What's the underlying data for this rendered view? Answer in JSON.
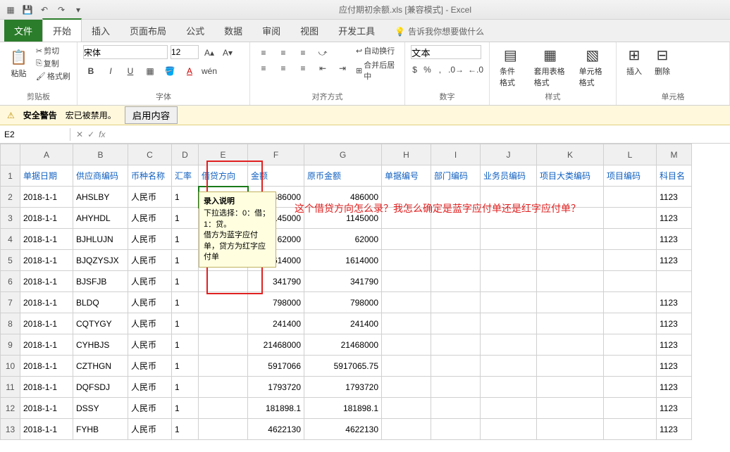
{
  "title": "应付期初余额.xls [兼容模式] - Excel",
  "qat_icons": [
    "excel-icon",
    "save-icon",
    "undo-icon",
    "redo-icon",
    "more-icon"
  ],
  "tabs": {
    "file": "文件",
    "home": "开始",
    "insert": "插入",
    "layout": "页面布局",
    "formulas": "公式",
    "data": "数据",
    "review": "审阅",
    "view": "视图",
    "dev": "开发工具",
    "tellme": "告诉我你想要做什么"
  },
  "ribbon": {
    "clipboard": {
      "paste": "粘贴",
      "cut": "剪切",
      "copy": "复制",
      "painter": "格式刷",
      "label": "剪贴板"
    },
    "font": {
      "name": "宋体",
      "size": "12",
      "label": "字体"
    },
    "align": {
      "label": "对齐方式",
      "wrap": "自动换行",
      "merge": "合并后居中"
    },
    "number": {
      "label": "数字",
      "fmt": "文本"
    },
    "styles": {
      "label": "样式",
      "cond": "条件格式",
      "table": "套用表格格式",
      "cell": "单元格格式"
    },
    "cells": {
      "label": "单元格",
      "ins": "插入",
      "del": "删除"
    }
  },
  "warning": {
    "prefix": "安全警告",
    "msg": "宏已被禁用。",
    "btn": "启用内容"
  },
  "namebox": "E2",
  "cols": [
    "A",
    "B",
    "C",
    "D",
    "E",
    "F",
    "G",
    "H",
    "I",
    "J",
    "K",
    "L"
  ],
  "headers": {
    "A": "单据日期",
    "B": "供应商编码",
    "C": "币种名称",
    "D": "汇率",
    "E": "借贷方向",
    "F": "金额",
    "G": "原币金额",
    "H": "单据编号",
    "I": "部门编码",
    "J": "业务员编码",
    "K": "项目大类编码",
    "L": "项目编码",
    "M": "科目名"
  },
  "tooltip": {
    "title": "录入说明",
    "body": "下拉选择：0：借；1：贷。\n借方为蓝字应付单，贷方为红字应付单"
  },
  "annotation": "这个借贷方向怎么录？我怎么确定是蓝字应付单还是红字应付单？",
  "rows": [
    {
      "A": "2018-1-1",
      "B": "AHSLBY",
      "C": "人民币",
      "D": "1",
      "F": "486000",
      "G": "486000",
      "M": "1123"
    },
    {
      "A": "2018-1-1",
      "B": "AHYHDL",
      "C": "人民币",
      "D": "1",
      "F": "145000",
      "G": "1145000",
      "M": "1123"
    },
    {
      "A": "2018-1-1",
      "B": "BJHLUJN",
      "C": "人民币",
      "D": "1",
      "F": "62000",
      "G": "62000",
      "M": "1123"
    },
    {
      "A": "2018-1-1",
      "B": "BJQZYSJX",
      "C": "人民币",
      "D": "1",
      "F": "614000",
      "G": "1614000",
      "M": "1123"
    },
    {
      "A": "2018-1-1",
      "B": "BJSFJB",
      "C": "人民币",
      "D": "1",
      "F": "341790",
      "G": "341790",
      "M": ""
    },
    {
      "A": "2018-1-1",
      "B": "BLDQ",
      "C": "人民币",
      "D": "1",
      "F": "798000",
      "G": "798000",
      "M": "1123"
    },
    {
      "A": "2018-1-1",
      "B": "CQTYGY",
      "C": "人民币",
      "D": "1",
      "F": "241400",
      "G": "241400",
      "M": "1123"
    },
    {
      "A": "2018-1-1",
      "B": "CYHBJS",
      "C": "人民币",
      "D": "1",
      "F": "21468000",
      "G": "21468000",
      "M": "1123"
    },
    {
      "A": "2018-1-1",
      "B": "CZTHGN",
      "C": "人民币",
      "D": "1",
      "F": "5917066",
      "G": "5917065.75",
      "M": "1123"
    },
    {
      "A": "2018-1-1",
      "B": "DQFSDJ",
      "C": "人民币",
      "D": "1",
      "F": "1793720",
      "G": "1793720",
      "M": "1123"
    },
    {
      "A": "2018-1-1",
      "B": "DSSY",
      "C": "人民币",
      "D": "1",
      "F": "181898.1",
      "G": "181898.1",
      "M": "1123"
    },
    {
      "A": "2018-1-1",
      "B": "FYHB",
      "C": "人民币",
      "D": "1",
      "F": "4622130",
      "G": "4622130",
      "M": "1123"
    }
  ],
  "colwidths": {
    "A": 75,
    "B": 78,
    "C": 62,
    "D": 38,
    "E": 70,
    "F": 80,
    "G": 110,
    "H": 70,
    "I": 70,
    "J": 80,
    "K": 95,
    "L": 75,
    "M": 50
  }
}
